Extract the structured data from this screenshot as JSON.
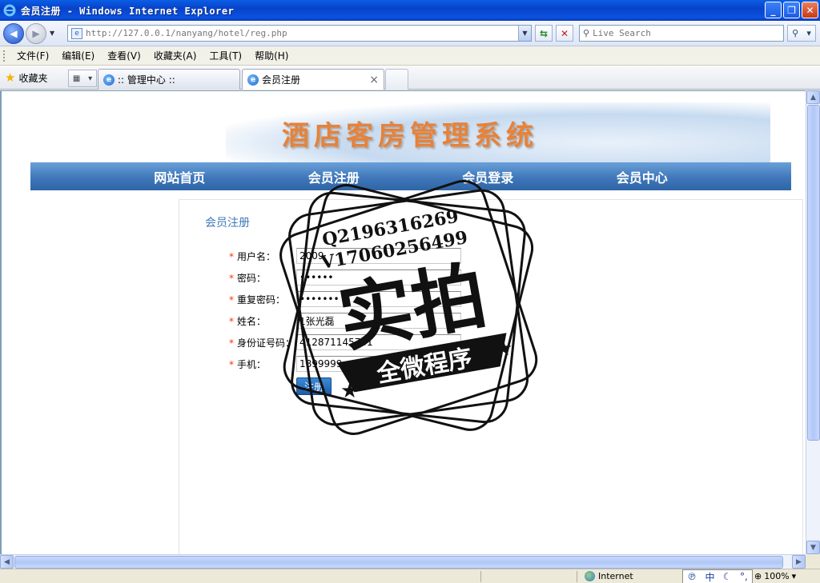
{
  "window": {
    "title": "会员注册 - Windows Internet Explorer"
  },
  "addressbar": {
    "url": "http://127.0.0.1/nanyang/hotel/reg.php",
    "search_placeholder": "Live Search"
  },
  "menu": {
    "items": [
      "文件(F)",
      "编辑(E)",
      "查看(V)",
      "收藏夹(A)",
      "工具(T)",
      "帮助(H)"
    ]
  },
  "tabs": {
    "favorites_label": "收藏夹",
    "items": [
      {
        "label": ":: 管理中心 ::"
      },
      {
        "label": "会员注册"
      }
    ]
  },
  "site": {
    "title": "酒店客房管理系统",
    "nav": [
      "网站首页",
      "会员注册",
      "会员登录",
      "会员中心"
    ]
  },
  "form": {
    "section_title": "会员注册",
    "required_mark": "*",
    "fields": [
      {
        "label": "用户名：",
        "value": "2009"
      },
      {
        "label": "密码：",
        "value": "••••••"
      },
      {
        "label": "重复密码：",
        "value": "•••••••"
      },
      {
        "label": "姓名：",
        "value": "1张光磊"
      },
      {
        "label": "身份证号码：",
        "value": "412871145781"
      },
      {
        "label": "手机：",
        "value": "1899999"
      }
    ],
    "submit_label": "注册"
  },
  "watermark": {
    "line1": "Q2196316269",
    "line2": "V17060256499",
    "main": "实拍",
    "banner": "全微程序"
  },
  "statusbar": {
    "zone": "Internet",
    "ime_label": "中",
    "zoom": "100%"
  },
  "colors": {
    "accent": "#e6823a",
    "nav_blue": "#3f77ba",
    "title_blue": "#3f7ab8",
    "required_red": "#ff3300"
  }
}
